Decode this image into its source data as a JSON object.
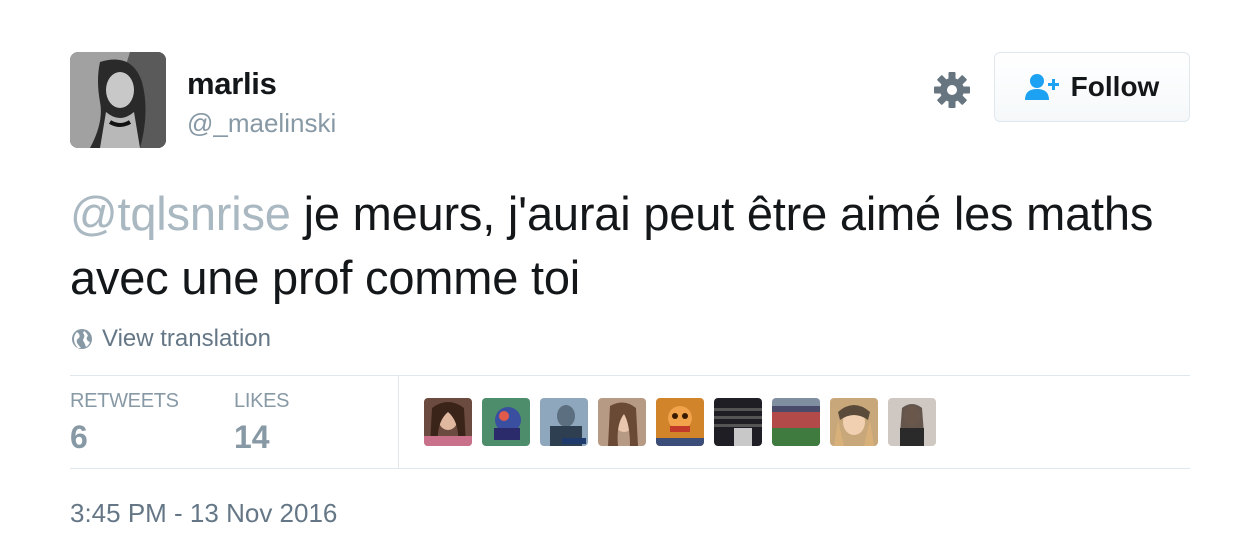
{
  "user": {
    "name": "marlis",
    "handle": "@_maelinski"
  },
  "actions": {
    "follow_label": "Follow",
    "settings_icon": "gear-icon",
    "follow_icon": "add-user-icon"
  },
  "tweet": {
    "mention": "@tqlsnrise",
    "text": " je meurs, j'aurai peut être aimé les maths avec une prof comme toi",
    "translate_label": "View translation",
    "translate_icon": "globe-icon"
  },
  "stats": {
    "retweets_label": "RETWEETS",
    "retweets_count": "6",
    "likes_label": "LIKES",
    "likes_count": "14"
  },
  "likers_count_shown": 9,
  "timestamp": "3:45 PM - 13 Nov 2016",
  "colors": {
    "text": "#14171a",
    "secondary": "#8899a6",
    "mention": "#aab8c2",
    "follow_icon": "#1da1f2"
  }
}
